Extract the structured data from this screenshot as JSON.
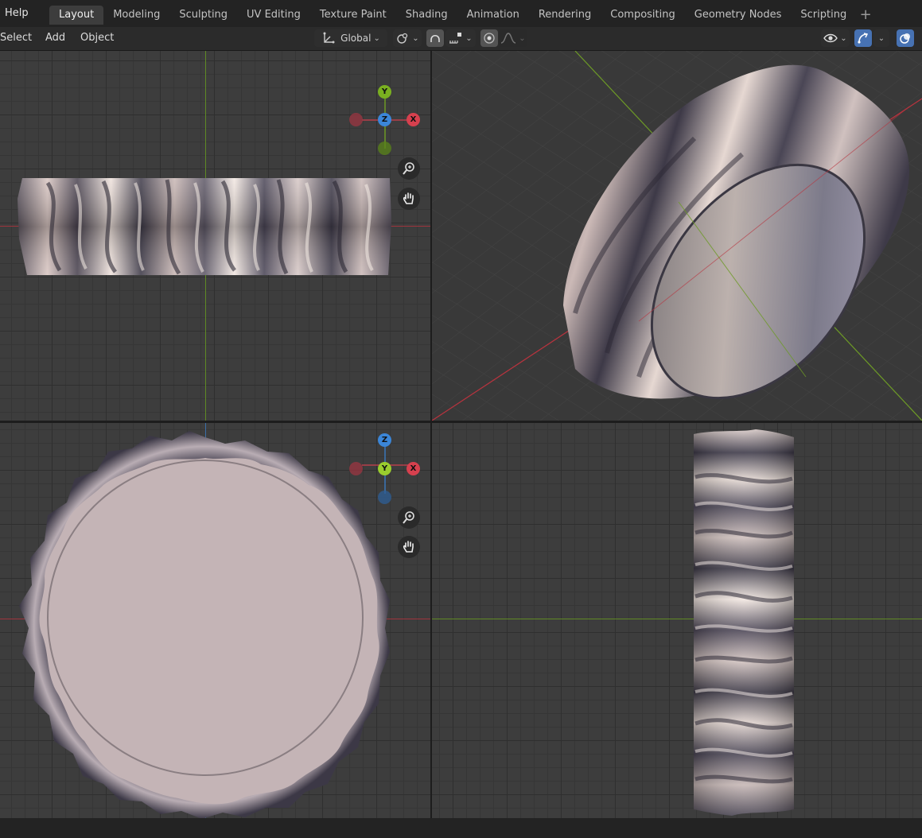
{
  "topbar": {
    "help": "Help",
    "tabs": [
      "Layout",
      "Modeling",
      "Sculpting",
      "UV Editing",
      "Texture Paint",
      "Shading",
      "Animation",
      "Rendering",
      "Compositing",
      "Geometry Nodes",
      "Scripting"
    ],
    "active_tab": "Layout"
  },
  "header": {
    "menus": [
      "Select",
      "Add",
      "Object"
    ],
    "transform_orientation": "Global"
  },
  "gizmo_top": {
    "labels": [
      "Y",
      "Z",
      "X"
    ]
  },
  "gizmo_bottom": {
    "labels": [
      "Z",
      "Y",
      "X"
    ]
  },
  "colors": {
    "axis_x": "#d6404e",
    "axis_y": "#7ab020",
    "axis_z": "#3b86d8",
    "accent": "#4772b3"
  },
  "icons": [
    "transform-orientation-icon",
    "pivot-icon",
    "snap-magnet-icon",
    "snap-increment-icon",
    "proportional-edit-icon",
    "falloff-icon",
    "visibility-icon",
    "gizmo-icon",
    "overlay-icon",
    "zoom-icon",
    "hand-pan-icon"
  ]
}
